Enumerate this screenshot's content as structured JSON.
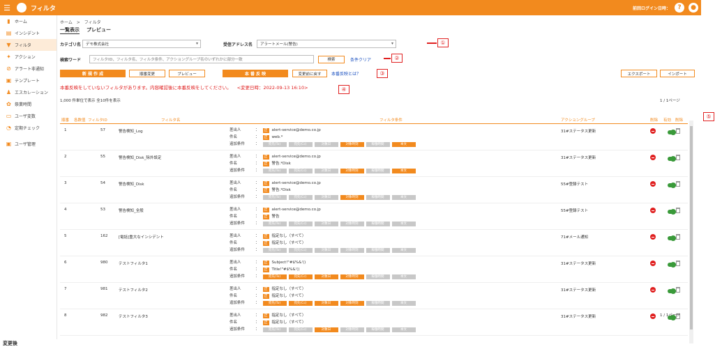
{
  "app": {
    "title": "フィルタ",
    "last_login_label": "前回ログイン日時：",
    "help_icon": "?"
  },
  "sidebar": {
    "items": [
      {
        "label": "ホーム",
        "icon": "bar-chart-icon"
      },
      {
        "label": "インシデント",
        "icon": "clipboard-icon"
      },
      {
        "label": "フィルタ",
        "icon": "filter-icon",
        "active": true
      },
      {
        "label": "アクション",
        "icon": "runner-icon"
      },
      {
        "label": "アラート非通知",
        "icon": "no-icon"
      },
      {
        "label": "テンプレート",
        "icon": "document-icon"
      },
      {
        "label": "エスカレーション",
        "icon": "people-icon"
      },
      {
        "label": "祭業時間",
        "icon": "gear-icon"
      },
      {
        "label": "ユーザ変数",
        "icon": "variable-icon"
      },
      {
        "label": "定期チェック",
        "icon": "stopwatch-icon"
      },
      {
        "label": "ユーザ管理",
        "icon": "user-icon"
      }
    ]
  },
  "breadcrumb": {
    "home": "ホーム",
    "sep": ">",
    "current": "フィルタ"
  },
  "tabs": [
    {
      "label": "一覧表示"
    },
    {
      "label": "プレビュー"
    }
  ],
  "form": {
    "category_label": "カテゴリ名",
    "category_value": "デモ株式会社",
    "address_label": "受信アドレス名",
    "address_value": "アラートメール(警告)",
    "search_label": "検索ワード",
    "search_placeholder": "フィルタID、フィルタ名、フィルタ条件、アクショングループ名のいずれかに部分一致",
    "search_button": "検索",
    "clear_link": "条件クリア"
  },
  "toolbar": {
    "new": "新 規 作 成",
    "order": "順番変更",
    "preview": "プレビュー",
    "apply": "本 番 反 映",
    "revert": "変更前に戻す",
    "what_link": "本番反映とは？",
    "export": "エクスポート",
    "import": "インポート"
  },
  "warning": {
    "text": "本番反映をしていないフィルタがあります。内容確認後に本番反映をしてください。",
    "changed": "<変更日時：2022-09-13 16:10>"
  },
  "paging": {
    "summary": "1,000 件単位で表示 全10件を表示",
    "page": "1 / 1ページ"
  },
  "markers": [
    "①",
    "②",
    "③",
    "④",
    "⑤"
  ],
  "table": {
    "headers": {
      "order": "順番",
      "seq": "各数值",
      "id": "フィルタID",
      "name": "フィルタ名",
      "cond": "フィルタ条件",
      "group": "アクショングループ",
      "del": "削除",
      "valid": "有効",
      "remove": "削除"
    },
    "cond_labels": {
      "from": "差出人",
      "subject": "件名",
      "extra": "追加条件",
      "colon": "："
    },
    "chips": [
      "宛先(To)",
      "宛先(Cc)",
      "対象日",
      "対象時刻",
      "稼働時間",
      "本文"
    ],
    "rows": [
      {
        "no": "1",
        "id": "57",
        "name": "警告検知_Log",
        "from_badge": "正",
        "from": "alert-service@demo.co.jp",
        "subj_badge": "正",
        "subj": "web.*",
        "chips": [
          0,
          0,
          0,
          1,
          0,
          1
        ],
        "group": "31#ステータス更新"
      },
      {
        "no": "2",
        "id": "55",
        "name": "警告検知_Disk_除外設定",
        "from_badge": "正",
        "from": "alert-service@demo.co.jp",
        "subj_badge": "正",
        "subj": "警告.*Disk",
        "chips": [
          0,
          0,
          0,
          1,
          0,
          1
        ],
        "group": "31#ステータス更新"
      },
      {
        "no": "3",
        "id": "54",
        "name": "警告検知_Disk",
        "from_badge": "正",
        "from": "alert-service@demo.co.jp",
        "subj_badge": "正",
        "subj": "警告.*Disk",
        "chips": [
          0,
          0,
          0,
          1,
          0,
          0
        ],
        "group": "55#登録テスト"
      },
      {
        "no": "4",
        "id": "53",
        "name": "警告検知_全般",
        "from_badge": "正",
        "from": "alert-service@demo.co.jp",
        "subj_badge": "正",
        "subj": "警告",
        "chips": [
          0,
          0,
          0,
          0,
          0,
          0
        ],
        "group": "55#登録テスト"
      },
      {
        "no": "5",
        "id": "162",
        "name": "[電話]重大なインシデント",
        "from_badge": "正",
        "from": "指定なし（すべて）",
        "subj_badge": "正",
        "subj": "指定なし（すべて）",
        "chips": [
          0,
          0,
          0,
          0,
          0,
          0
        ],
        "group": "71#メール通知"
      },
      {
        "no": "6",
        "id": "980",
        "name": "テストフィルタ1",
        "from_badge": "正",
        "from": "Subject!\"#$%&'()",
        "subj_badge": "正",
        "subj": "Title!\"#$%&'()",
        "chips": [
          1,
          1,
          1,
          1,
          0,
          0
        ],
        "group": "31#ステータス更新"
      },
      {
        "no": "7",
        "id": "981",
        "name": "テストフィルタ2",
        "from_badge": "正",
        "from": "指定なし（すべて）",
        "subj_badge": "正",
        "subj": "指定なし（すべて）",
        "chips": [
          1,
          1,
          1,
          1,
          0,
          0
        ],
        "group": "31#ステータス更新"
      },
      {
        "no": "8",
        "id": "982",
        "name": "テストフィルタ3",
        "from_badge": "正",
        "from": "指定なし（すべて）",
        "subj_badge": "正",
        "subj": "指定なし（すべて）",
        "chips": [
          0,
          0,
          1,
          0,
          0,
          0
        ],
        "group": "31#ステータス更新"
      }
    ]
  },
  "footer_label": "変更後"
}
